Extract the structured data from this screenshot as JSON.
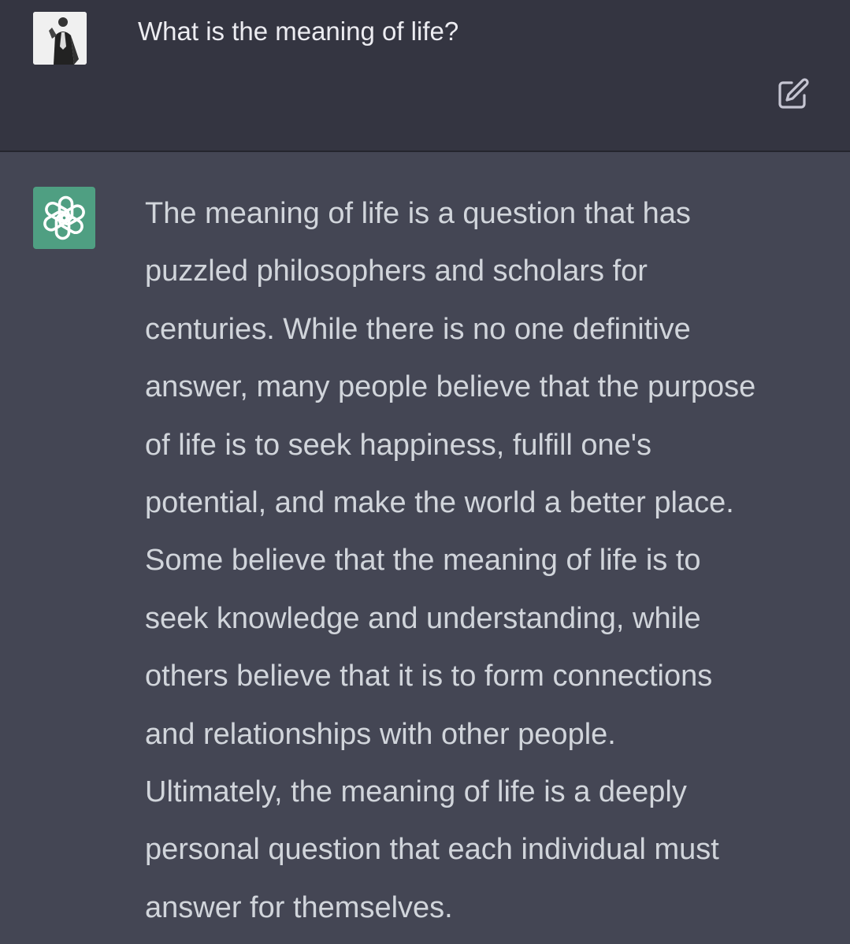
{
  "user_message": {
    "text": "What is the meaning of life?",
    "avatar_icon": "user-photo-avatar",
    "edit_icon": "edit-icon"
  },
  "assistant_message": {
    "avatar_icon": "openai-logo-icon",
    "lines": [
      "The meaning of life is a question that has",
      "puzzled philosophers and scholars for",
      "centuries. While there is no one definitive",
      "answer, many people believe that the purpose",
      "of life is to seek happiness, fulfill one's",
      "potential, and make the world a better place.",
      "Some believe that the meaning of life is to",
      "seek knowledge and understanding, while",
      "others believe that it is to form connections",
      "and relationships with other people.",
      "Ultimately, the meaning of life is a deeply",
      "personal question that each individual must",
      "answer for themselves."
    ]
  },
  "colors": {
    "user_bg": "#343541",
    "assistant_bg": "#444654",
    "assistant_avatar_bg": "#4f9f82",
    "text": "#d1d5db"
  }
}
